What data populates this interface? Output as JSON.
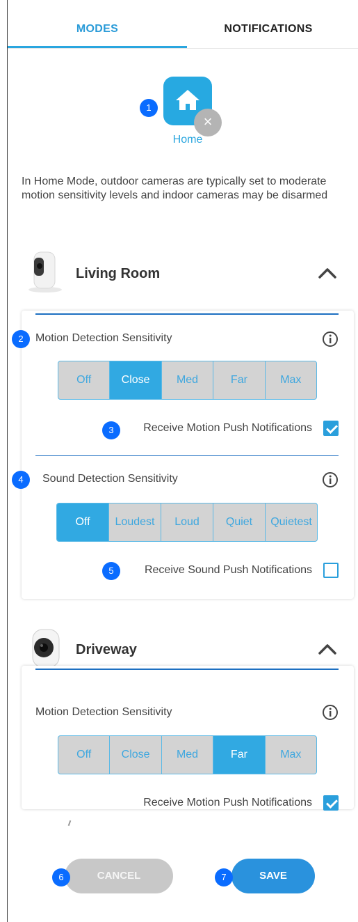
{
  "tabs": {
    "modes": "MODES",
    "notifications": "NOTIFICATIONS"
  },
  "mode": {
    "icon": "home-icon",
    "label": "Home",
    "description": "In Home Mode, outdoor cameras are typically set to moderate motion sensitivity levels and indoor cameras may be disarmed",
    "remove_glyph": "×"
  },
  "badges": [
    "1",
    "2",
    "3",
    "4",
    "5",
    "6",
    "7"
  ],
  "cameras": [
    {
      "name": "Living Room",
      "motion": {
        "title": "Motion Detection Sensitivity",
        "options": [
          "Off",
          "Close",
          "Med",
          "Far",
          "Max"
        ],
        "selected": "Close",
        "push_label": "Receive Motion Push Notifications",
        "push_checked": true
      },
      "sound": {
        "title": "Sound Detection Sensitivity",
        "options": [
          "Off",
          "Loudest",
          "Loud",
          "Quiet",
          "Quietest"
        ],
        "selected": "Off",
        "push_label": "Receive Sound Push Notifications",
        "push_checked": false
      }
    },
    {
      "name": "Driveway",
      "motion": {
        "title": "Motion Detection Sensitivity",
        "options": [
          "Off",
          "Close",
          "Med",
          "Far",
          "Max"
        ],
        "selected": "Far",
        "push_label": "Receive Motion Push Notifications",
        "push_checked": true
      }
    }
  ],
  "buttons": {
    "cancel": "CANCEL",
    "save": "SAVE"
  },
  "colors": {
    "accent": "#27a9e1",
    "badge": "#0a6cff",
    "divider": "#1d6fc1"
  }
}
